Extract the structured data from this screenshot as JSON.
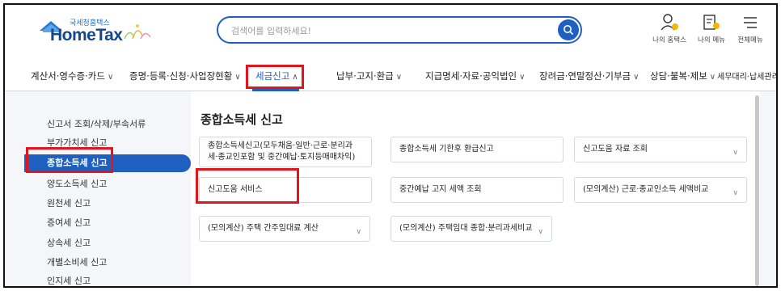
{
  "header": {
    "logo_top": "국세청홈택스",
    "logo_main": "HomeTax",
    "search_placeholder": "검색어를 입력하세요!",
    "util": [
      {
        "label": "나의 홈택스",
        "icon": "person-icon"
      },
      {
        "label": "나의 메뉴",
        "icon": "my-menu-icon"
      },
      {
        "label": "전체메뉴",
        "icon": "hamburger-icon"
      }
    ]
  },
  "gnb": [
    {
      "label": "계산서·영수증·카드",
      "chevron": "∨"
    },
    {
      "label": "증명·등록·신청·사업장현황",
      "chevron": "∨"
    },
    {
      "label": "세금신고",
      "chevron": "∧",
      "active": true
    },
    {
      "label": "납부·고지·환급",
      "chevron": "∨"
    },
    {
      "label": "지급명세·자료·공익법인",
      "chevron": "∨"
    },
    {
      "label": "장려금·연말정산·기부금",
      "chevron": "∨"
    },
    {
      "label": "상담·불복·제보",
      "chevron": "∨"
    },
    {
      "label": "세무대리·납세관리",
      "chevron": "∨"
    }
  ],
  "lnb": [
    {
      "label": "신고서 조회/삭제/부속서류"
    },
    {
      "label": "부가가치세 신고"
    },
    {
      "label": "종합소득세 신고",
      "active": true
    },
    {
      "label": "양도소득세 신고"
    },
    {
      "label": "원천세 신고"
    },
    {
      "label": "증여세 신고"
    },
    {
      "label": "상속세 신고"
    },
    {
      "label": "개별소비세 신고"
    },
    {
      "label": "인지세 신고"
    }
  ],
  "content": {
    "title": "종합소득세 신고",
    "cards": [
      {
        "line1": "종합소득세신고(모두채움·일반·근로·분리과",
        "line2": "세·종교인포함 및 중간예납·토지등매매차익)",
        "chevron": ""
      },
      {
        "line1": "종합소득세 기한후 환급신고",
        "line2": "",
        "chevron": ""
      },
      {
        "line1": "신고도움 자료 조회",
        "line2": "",
        "chevron": "∨"
      },
      {
        "line1": "신고도움 서비스",
        "line2": "",
        "chevron": ""
      },
      {
        "line1": "중간예납 고지 세액 조회",
        "line2": "",
        "chevron": ""
      },
      {
        "line1": "(모의계산) 근로·종교인소득 세액비교",
        "line2": "",
        "chevron": "∨"
      },
      {
        "line1": "(모의계산) 주택 간주임대료 계산",
        "line2": "",
        "chevron": "∨"
      },
      {
        "line1": "(모의계산) 주택임대 종합·분리과세비교",
        "line2": "",
        "chevron": "∨"
      }
    ]
  },
  "colors": {
    "brand": "#1f5fbf",
    "highlight": "#e4141c",
    "logo": "#12488f"
  }
}
